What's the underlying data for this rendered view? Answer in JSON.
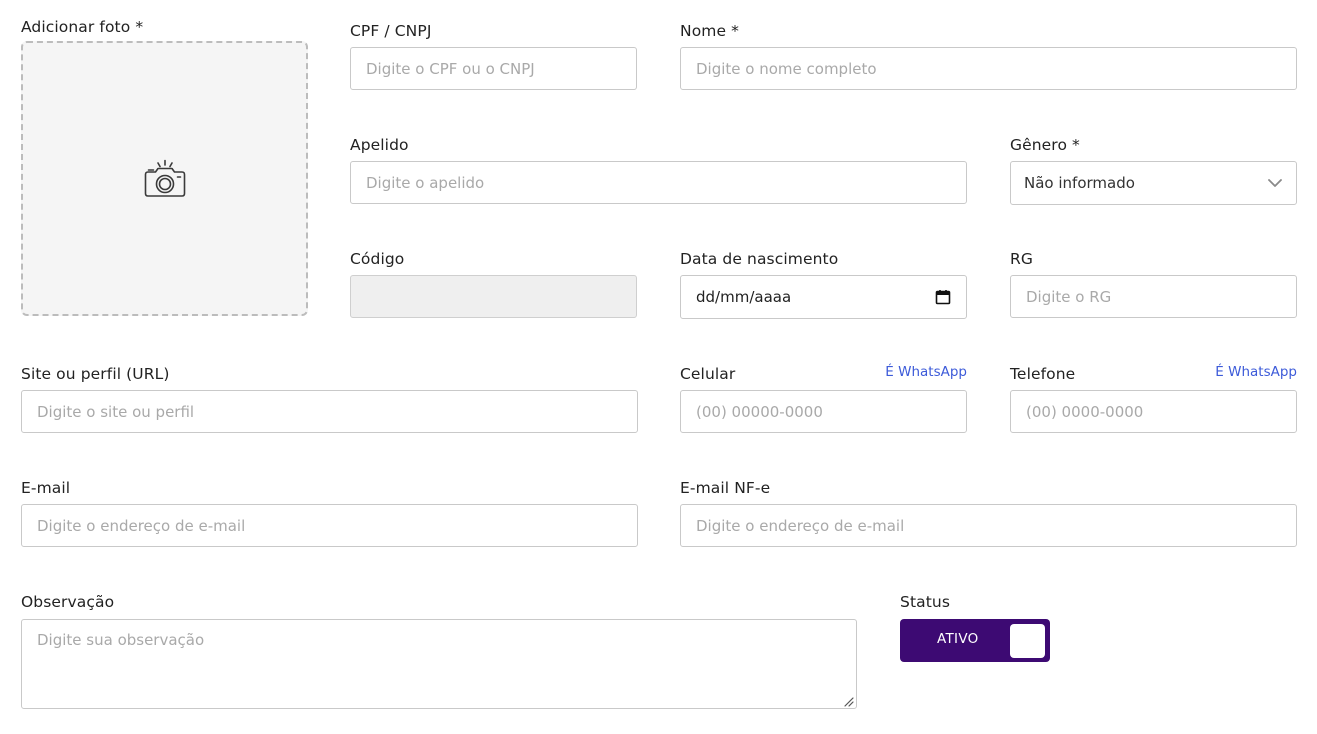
{
  "photo": {
    "label": "Adicionar foto *",
    "icon": "camera-icon"
  },
  "cpf": {
    "label": "CPF / CNPJ",
    "placeholder": "Digite o CPF ou o CNPJ",
    "value": ""
  },
  "nome": {
    "label": "Nome *",
    "placeholder": "Digite o nome completo",
    "value": ""
  },
  "apelido": {
    "label": "Apelido",
    "placeholder": "Digite o apelido",
    "value": ""
  },
  "genero": {
    "label": "Gênero *",
    "selected": "Não informado"
  },
  "codigo": {
    "label": "Código",
    "value": ""
  },
  "nascimento": {
    "label": "Data de nascimento",
    "display": "dd/mm/aaaa"
  },
  "rg": {
    "label": "RG",
    "placeholder": "Digite o RG",
    "value": ""
  },
  "site": {
    "label": "Site ou perfil (URL)",
    "placeholder": "Digite o site ou perfil",
    "value": ""
  },
  "celular": {
    "label": "Celular",
    "whatsapp_link": "É WhatsApp",
    "placeholder": "(00) 00000-0000",
    "value": ""
  },
  "telefone": {
    "label": "Telefone",
    "whatsapp_link": "É WhatsApp",
    "placeholder": "(00) 0000-0000",
    "value": ""
  },
  "email": {
    "label": "E-mail",
    "placeholder": "Digite o endereço de e-mail",
    "value": ""
  },
  "email_nfe": {
    "label": "E-mail NF-e",
    "placeholder": "Digite o endereço de e-mail",
    "value": ""
  },
  "observacao": {
    "label": "Observação",
    "placeholder": "Digite sua observação",
    "value": ""
  },
  "status": {
    "label": "Status",
    "toggle_text": "ATIVO",
    "on": true
  },
  "colors": {
    "accent": "#3d0a73",
    "link": "#3d5bd9",
    "border": "#c9c9c9",
    "placeholder": "#a9a9a9"
  }
}
